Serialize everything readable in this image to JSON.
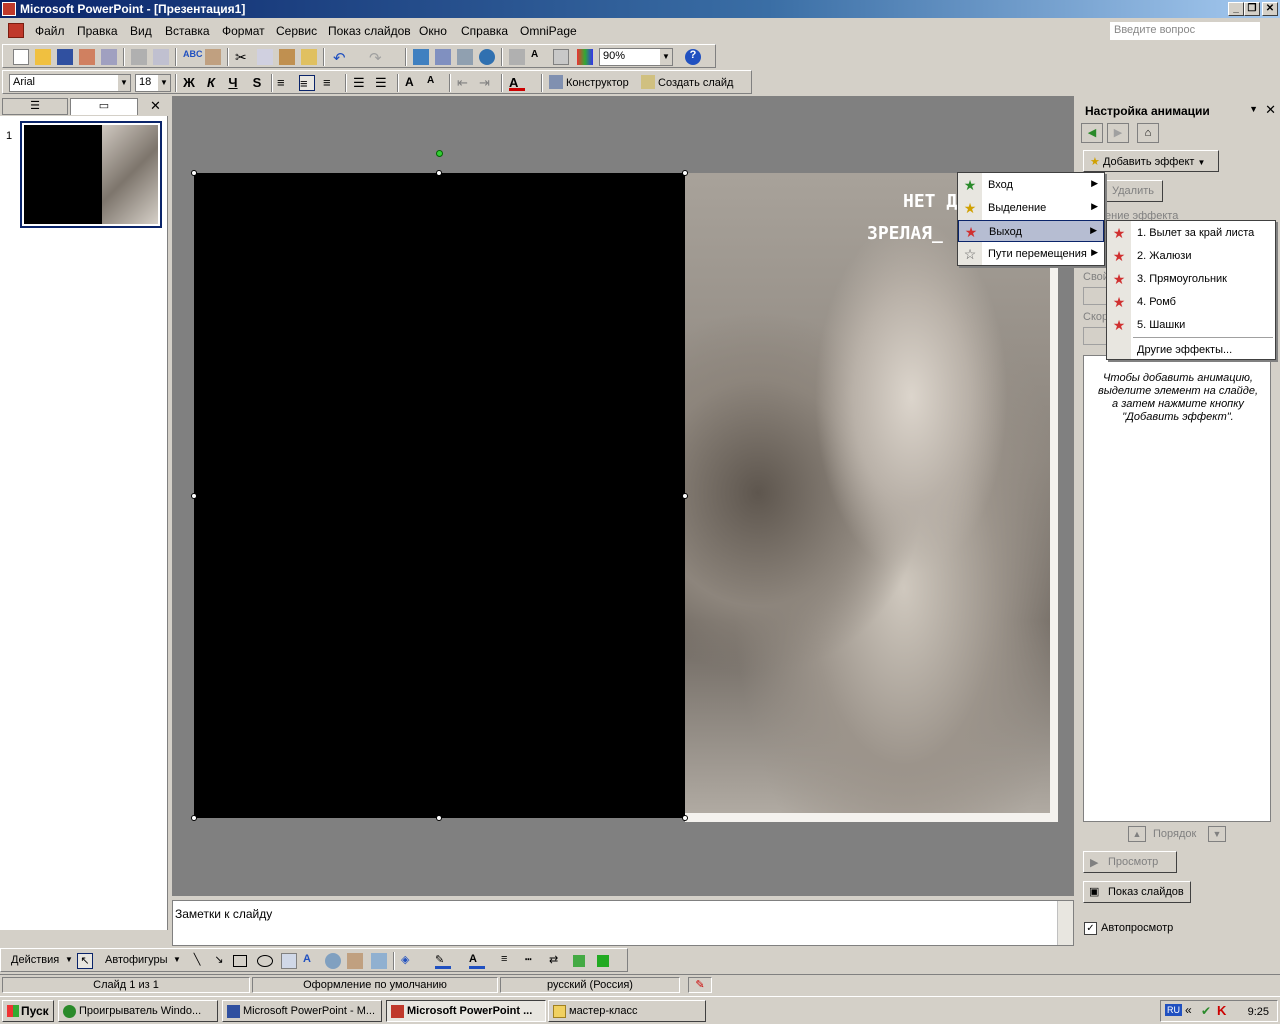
{
  "window": {
    "title": "Microsoft PowerPoint - [Презентация1]",
    "ask_placeholder": "Введите вопрос"
  },
  "menu": [
    "Файл",
    "Правка",
    "Вид",
    "Вставка",
    "Формат",
    "Сервис",
    "Показ слайдов",
    "Окно",
    "Справка",
    "OmniPage"
  ],
  "toolbar": {
    "zoom": "90%",
    "font_name": "Arial",
    "font_size": "18",
    "bold": "Ж",
    "italic": "К",
    "underline": "Ч",
    "shadow": "S",
    "designer": "Конструктор",
    "new_slide": "Создать слайд"
  },
  "slides_pane": {
    "slide_number": "1"
  },
  "slide": {
    "overlay_line1": "НЕТ Д",
    "overlay_line2": "ЗРЕЛАЯ_"
  },
  "notes": {
    "placeholder": "Заметки к слайду"
  },
  "taskpane": {
    "title": "Настройка анимации",
    "add_effect": "Добавить эффект",
    "remove": "Удалить",
    "change_label": "ение эффекта",
    "property_label": "Свой",
    "speed_label": "Скор",
    "hint": "Чтобы добавить анимацию, выделите элемент на слайде, а затем нажмите кнопку \"Добавить эффект\".",
    "order": "Порядок",
    "preview": "Просмотр",
    "slideshow": "Показ слайдов",
    "autopreview": "Автопросмотр",
    "autopreview_checked": true
  },
  "effect_menu": [
    {
      "label": "Вход",
      "icon": "star-green-icon"
    },
    {
      "label": "Выделение",
      "icon": "star-yellow-icon"
    },
    {
      "label": "Выход",
      "icon": "star-red-icon"
    },
    {
      "label": "Пути перемещения",
      "icon": "star-outline-icon"
    }
  ],
  "exit_submenu": [
    "1. Вылет за край листа",
    "2. Жалюзи",
    "3. Прямоугольник",
    "4. Ромб",
    "5. Шашки"
  ],
  "exit_submenu_more": "Другие эффекты...",
  "drawbar": {
    "actions": "Действия",
    "autoshapes": "Автофигуры"
  },
  "status": {
    "slide": "Слайд 1 из 1",
    "design": "Оформление по умолчанию",
    "language": "русский (Россия)"
  },
  "taskbar": {
    "start": "Пуск",
    "tasks": [
      "Проигрыватель Windo...",
      "Microsoft PowerPoint - M...",
      "Microsoft PowerPoint ...",
      "мастер-класс"
    ],
    "lang": "RU",
    "time": "9:25"
  }
}
